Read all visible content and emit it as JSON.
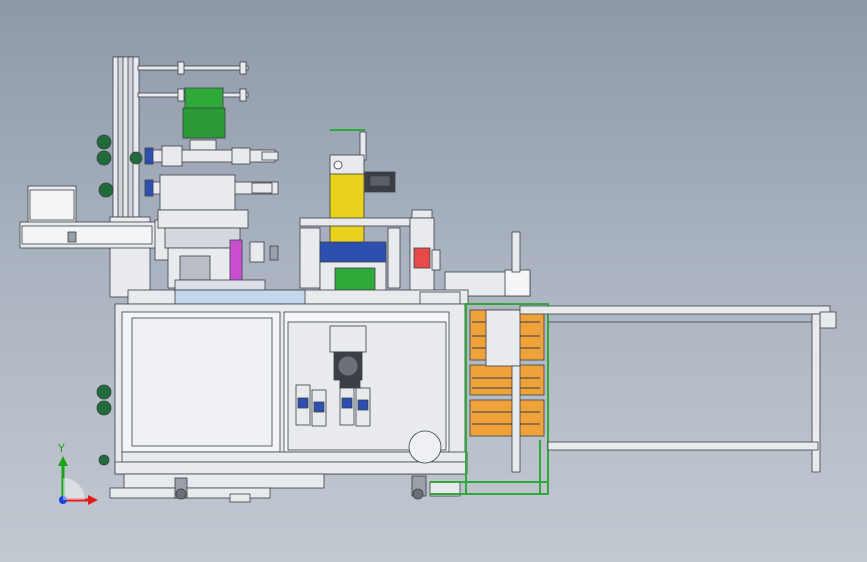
{
  "scene": {
    "type": "cad-assembly-front-view",
    "background_top": "#8e98a8",
    "background_bottom": "#c3c9d1"
  },
  "colors": {
    "frame": "#e8eaee",
    "outline": "#3a3f47",
    "green_part": "#2faa3a",
    "yellow_plate": "#e9d21b",
    "orange_bin": "#f0a23a",
    "blue_part": "#2d4fb0",
    "dark_green_wheel": "#1f6b3a"
  },
  "triad": {
    "y_label": "Y",
    "axis_y_color": "#19a319",
    "axis_x_color": "#e01b1b",
    "axis_z_color": "#1b3fe0"
  }
}
